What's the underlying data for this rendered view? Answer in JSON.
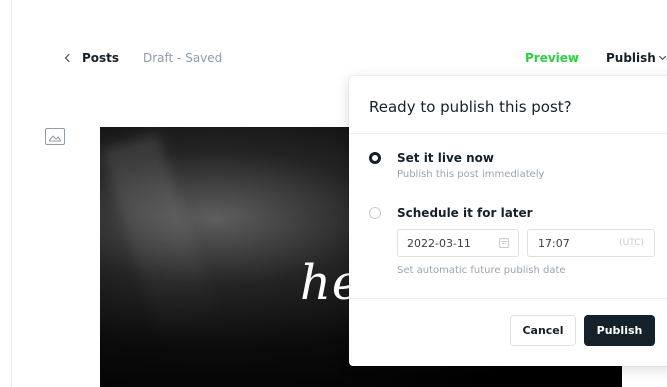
{
  "header": {
    "back_label": "Posts",
    "status": "Draft - Saved",
    "preview_label": "Preview",
    "publish_label": "Publish"
  },
  "editor": {
    "feature_image_text": "he",
    "image_icon": "image-icon"
  },
  "popover": {
    "title": "Ready to publish this post?",
    "options": [
      {
        "title": "Set it live now",
        "description": "Publish this post immediately",
        "selected": true
      },
      {
        "title": "Schedule it for later",
        "description": "",
        "selected": false
      }
    ],
    "schedule": {
      "date": "2022-03-11",
      "time": "17:07",
      "timezone": "(UTC)",
      "hint": "Set automatic future publish date"
    },
    "cancel_label": "Cancel",
    "publish_label": "Publish"
  },
  "colors": {
    "accent_green": "#30cf43",
    "dark": "#15212a",
    "muted": "#8e9cac"
  }
}
